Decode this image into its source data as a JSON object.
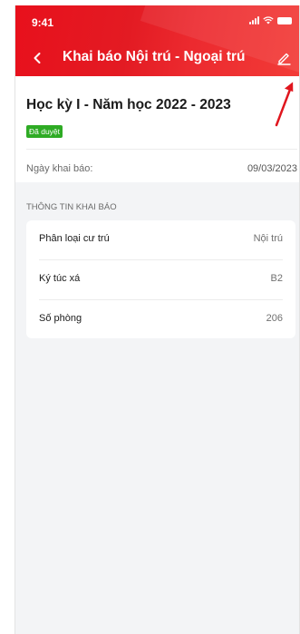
{
  "status_bar": {
    "time": "9:41"
  },
  "nav": {
    "back_icon": "chevron-left-icon",
    "title": "Khai báo Nội trú - Ngoại trú",
    "edit_icon": "pencil-icon"
  },
  "header": {
    "term": "Học kỳ I - Năm học 2022  - 2023",
    "status": "Đã duyệt",
    "declared_label": "Ngày khai báo:",
    "declared_date": "09/03/2023"
  },
  "info": {
    "section_title": "THÔNG TIN KHAI BÁO",
    "rows": [
      {
        "label": "Phân loại cư trú",
        "value": "Nội trú"
      },
      {
        "label": "Ký túc xá",
        "value": "B2"
      },
      {
        "label": "Số phòng",
        "value": "206"
      }
    ]
  },
  "colors": {
    "brand_red": "#e31b23",
    "badge_green": "#2eab24",
    "annotation_red": "#e0161e"
  }
}
